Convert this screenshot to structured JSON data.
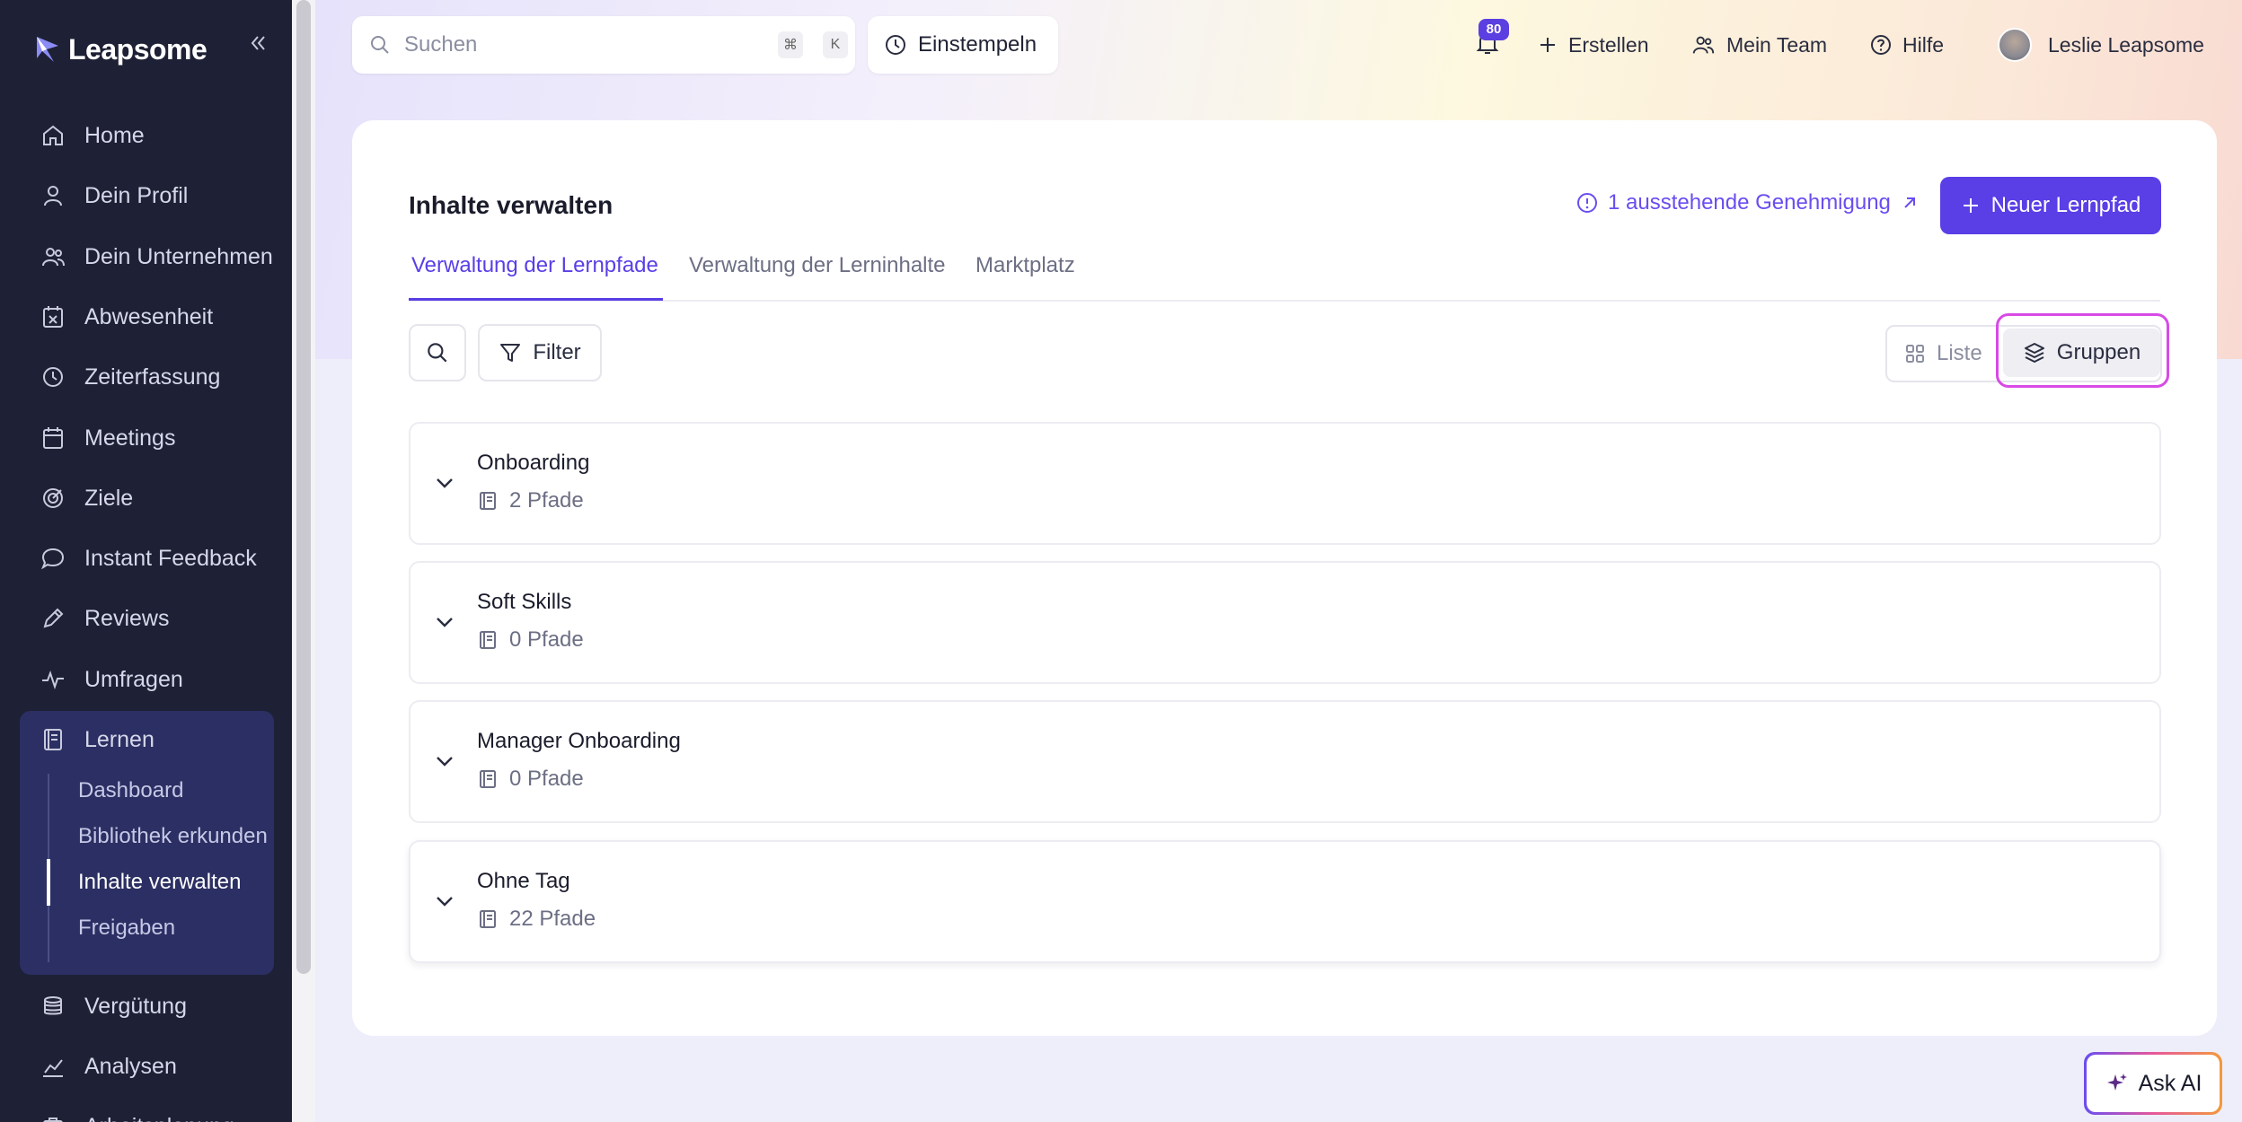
{
  "app": {
    "logo_text": "Leapsome",
    "brand_color": "#5a3ee6",
    "sidebar_color": "#1e2035"
  },
  "sidebar": {
    "collapse_icon": "chevrons-left-icon",
    "items": [
      {
        "label": "Home",
        "icon": "home-icon"
      },
      {
        "label": "Dein Profil",
        "icon": "user-icon"
      },
      {
        "label": "Dein Unternehmen",
        "icon": "users-icon"
      },
      {
        "label": "Abwesenheit",
        "icon": "calendar-x-icon"
      },
      {
        "label": "Zeiterfassung",
        "icon": "clock-icon"
      },
      {
        "label": "Meetings",
        "icon": "calendar-icon"
      },
      {
        "label": "Ziele",
        "icon": "target-icon"
      },
      {
        "label": "Instant Feedback",
        "icon": "chat-icon"
      },
      {
        "label": "Reviews",
        "icon": "pencil-icon"
      },
      {
        "label": "Umfragen",
        "icon": "pulse-icon"
      },
      {
        "label": "Lernen",
        "icon": "book-icon"
      },
      {
        "label": "Vergütung",
        "icon": "coins-icon"
      },
      {
        "label": "Analysen",
        "icon": "chart-icon"
      }
    ],
    "lernen_sub": [
      {
        "label": "Dashboard"
      },
      {
        "label": "Bibliothek erkunden"
      },
      {
        "label": "Inhalte verwalten"
      },
      {
        "label": "Freigaben"
      }
    ],
    "partial_item": "Arbeitsplanung"
  },
  "topbar": {
    "search_placeholder": "Suchen",
    "kbd_cmd": "⌘",
    "kbd_k": "K",
    "clock_in": "Einstempeln",
    "notification_count": "80",
    "create": "Erstellen",
    "team": "Mein Team",
    "help": "Hilfe",
    "user_name": "Leslie Leapsome"
  },
  "main": {
    "title": "Inhalte verwalten",
    "approval": "1 ausstehende Genehmigung",
    "new_button": "Neuer Lernpfad",
    "tabs": [
      {
        "label": "Verwaltung der Lernpfade",
        "active": true
      },
      {
        "label": "Verwaltung der Lerninhalte",
        "active": false
      },
      {
        "label": "Marktplatz",
        "active": false
      }
    ],
    "filter": "Filter",
    "view_list": "Liste",
    "view_groups": "Gruppen",
    "groups": [
      {
        "name": "Onboarding",
        "count": "2 Pfade"
      },
      {
        "name": "Soft Skills",
        "count": "0 Pfade"
      },
      {
        "name": "Manager Onboarding",
        "count": "0 Pfade"
      },
      {
        "name": "Ohne Tag",
        "count": "22 Pfade"
      }
    ]
  },
  "ask_ai": "Ask AI"
}
